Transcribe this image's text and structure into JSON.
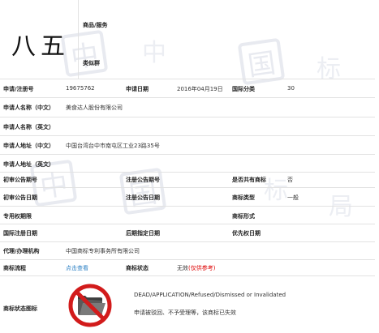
{
  "mark": {
    "text": "八五"
  },
  "goods": {
    "label": "商品/服务",
    "group_label": "类似群"
  },
  "fields": {
    "reg_no_label": "申请/注册号",
    "reg_no": "19675762",
    "apply_date_label": "申请日期",
    "apply_date": "2016年04月19日",
    "intl_class_label": "国际分类",
    "intl_class": "30",
    "name_cn_label": "申请人名称（中文）",
    "name_cn": "美食达人股份有限公司",
    "name_en_label": "申请人名称（英文）",
    "addr_cn_label": "申请人地址（中文）",
    "addr_cn": "中国台湾台中市南屯区工业23路35号",
    "addr_en_label": "申请人地址（英文）",
    "prelim_no_label": "初审公告期号",
    "reg_pub_no_label": "注册公告期号",
    "shared_label": "是否共有商标",
    "shared": "否",
    "prelim_date_label": "初审公告日期",
    "reg_pub_date_label": "注册公告日期",
    "type_label": "商标类型",
    "type": "一般",
    "period_label": "专用权期限",
    "form_label": "商标形式",
    "intl_reg_label": "国际注册日期",
    "later_date_label": "后期指定日期",
    "priority_label": "优先权日期",
    "agent_label": "代理/办理机构",
    "agent": "中国商标专利事务所有限公司",
    "flow_label": "商标流程",
    "flow_link": "点击查看",
    "status_label": "商标状态",
    "status": "无效",
    "status_note": "(仅供参考)",
    "icon_label": "商标状态图标",
    "status_en": "DEAD/APPLICATION/Refused/Dismissed or Invalidated",
    "status_cn": "申请被驳回、不予受理等，该商标已失效"
  },
  "colors": {
    "link": "#2a7fc4",
    "invalid": "#dd0000",
    "prohibit": "#d21b1b"
  },
  "icons": {
    "status": "prohibited-folder-icon"
  }
}
